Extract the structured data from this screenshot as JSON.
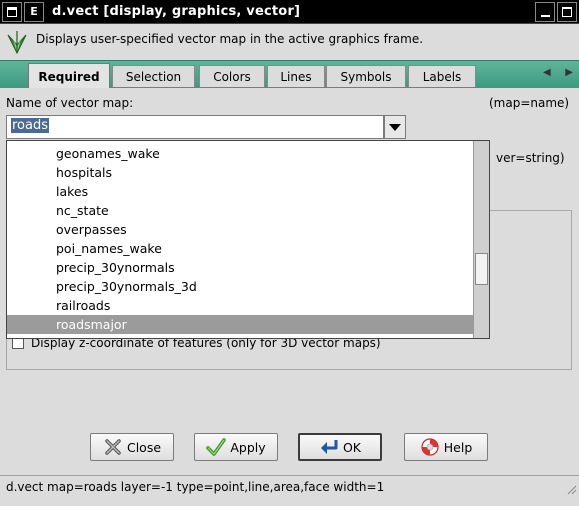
{
  "window": {
    "title": "d.vect [display, graphics, vector]",
    "menu_button_glyph": "menu-icon",
    "e_button_label": "E"
  },
  "description": "Displays user-specified vector map in the active graphics frame.",
  "tabs": [
    {
      "label": "Required",
      "active": true
    },
    {
      "label": "Selection"
    },
    {
      "label": "Colors"
    },
    {
      "label": "Lines"
    },
    {
      "label": "Symbols"
    },
    {
      "label": "Labels"
    }
  ],
  "form": {
    "map_label": "Name of vector map:",
    "map_hint": "(map=name)",
    "map_value": "roads",
    "hidden_hint": "ver=string)",
    "zcoord_label": "Display z-coordinate of features (only for 3D vector maps)"
  },
  "dropdown": {
    "items": [
      "geonames_wake",
      "hospitals",
      "lakes",
      "nc_state",
      "overpasses",
      "poi_names_wake",
      "precip_30ynormals",
      "precip_30ynormals_3d",
      "railroads",
      "roadsmajor"
    ],
    "selected": "roadsmajor"
  },
  "buttons": {
    "close": "Close",
    "apply": "Apply",
    "ok": "OK",
    "help": "Help"
  },
  "status": "d.vect map=roads layer=-1 type=point,line,area,face width=1",
  "colors": {
    "tabstrip": "#4aa88b",
    "selection": "#4c6a96",
    "dropdown_highlight": "#9b9b9b"
  }
}
